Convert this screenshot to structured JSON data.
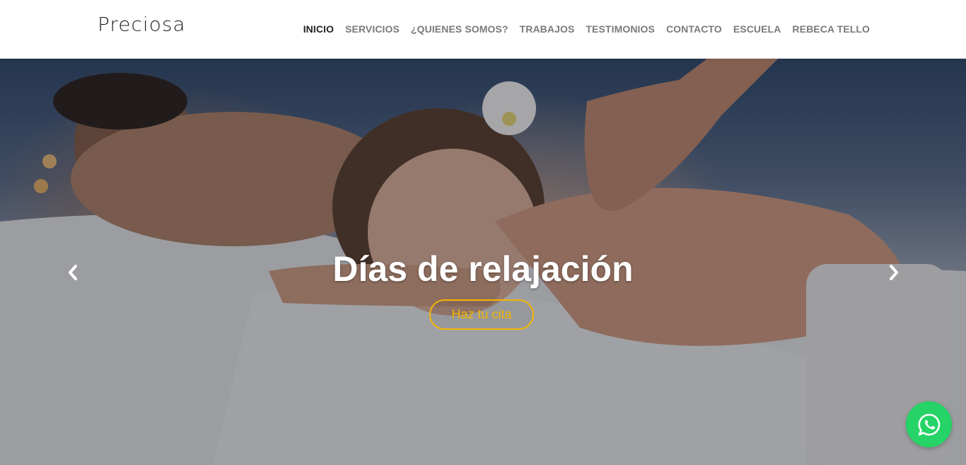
{
  "brand": {
    "logo_text": "Preciosa"
  },
  "nav": {
    "items": [
      {
        "label": "INICIO",
        "active": true
      },
      {
        "label": "SERVICIOS"
      },
      {
        "label": "¿QUIENES SOMOS?"
      },
      {
        "label": "TRABAJOS"
      },
      {
        "label": "TESTIMONIOS"
      },
      {
        "label": "CONTACTO"
      },
      {
        "label": "ESCUELA"
      },
      {
        "label": "REBECA TELLO"
      }
    ]
  },
  "hero": {
    "caption": "Días de relajación",
    "cta_label": "Haz tu cita",
    "prev_icon": "chevron-left-icon",
    "next_icon": "chevron-right-icon"
  },
  "whatsapp": {
    "icon": "whatsapp-icon"
  },
  "colors": {
    "accent": "#f2b600",
    "whatsapp": "#25d366",
    "nav_active": "#222222",
    "nav_inactive": "#7a7a7a"
  }
}
